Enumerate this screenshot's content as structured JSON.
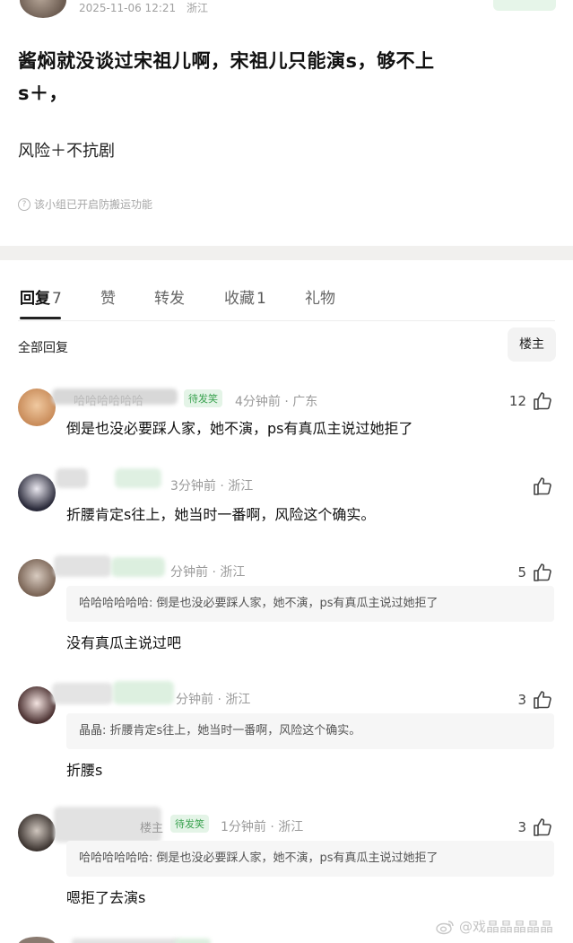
{
  "post": {
    "date": "2025-11-06 12:21",
    "location": "浙江",
    "body_line1": "酱焖就没谈过宋祖儿啊，宋祖儿只能演s，够不上",
    "body_line2": "s＋，",
    "body_line3": "风险＋不抗剧",
    "protect_notice": "该小组已开启防搬运功能"
  },
  "tabs": [
    {
      "label": "回复",
      "count": "7"
    },
    {
      "label": "赞",
      "count": ""
    },
    {
      "label": "转发",
      "count": ""
    },
    {
      "label": "收藏",
      "count": "1"
    },
    {
      "label": "礼物",
      "count": ""
    }
  ],
  "replies_header": {
    "all_replies": "全部回复",
    "louzhu": "楼主"
  },
  "comments": [
    {
      "name": "哈哈哈哈哈哈",
      "badge": "待发笑",
      "meta": "4分钟前 · 广东",
      "likes": "12",
      "text": "倒是也没必要踩人家，她不演，ps有真瓜主说过她拒了",
      "quote": ""
    },
    {
      "name": "",
      "badge": "",
      "meta": "3分钟前 · 浙江",
      "likes": "",
      "text": "折腰肯定s往上，她当时一番啊，风险这个确实。",
      "quote": ""
    },
    {
      "name": "",
      "badge": "",
      "meta": "分钟前 · 浙江",
      "likes": "5",
      "text": "没有真瓜主说过吧",
      "quote": "哈哈哈哈哈哈: 倒是也没必要踩人家，她不演，ps有真瓜主说过她拒了"
    },
    {
      "name": "",
      "badge": "",
      "meta": "分钟前 · 浙江",
      "likes": "3",
      "text": "折腰s",
      "quote": "晶晶: 折腰肯定s往上，她当时一番啊，风险这个确实。"
    },
    {
      "name": "楼主",
      "badge": "待发笑",
      "meta": "1分钟前 · 浙江",
      "likes": "3",
      "text": "嗯拒了去演s",
      "quote": "哈哈哈哈哈哈: 倒是也没必要踩人家，她不演，ps有真瓜主说过她拒了"
    }
  ],
  "watermark": "@戏晶晶晶晶晶",
  "colors": {
    "accent_green": "#3aa24f",
    "badge_bg": "#e4f4e7",
    "meta_gray": "#9a9a9a",
    "divider_band": "#f1f0ee"
  }
}
